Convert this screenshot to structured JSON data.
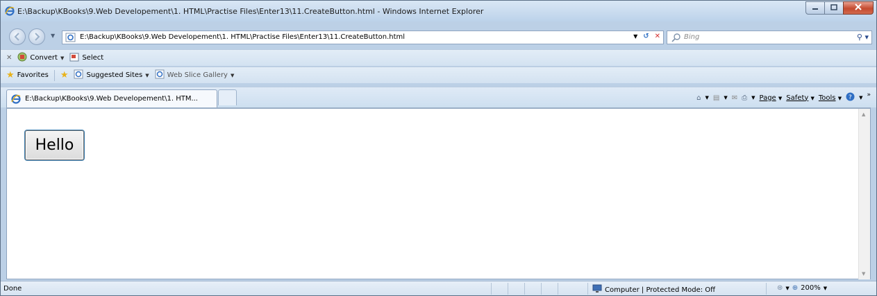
{
  "window": {
    "title": "E:\\Backup\\KBooks\\9.Web Developement\\1. HTML\\Practise Files\\Enter13\\11.CreateButton.html - Windows Internet Explorer",
    "controls": {
      "minimize": "minimize",
      "maximize": "maximize",
      "close": "close"
    }
  },
  "address_bar": {
    "url": "E:\\Backup\\KBooks\\9.Web Developement\\1. HTML\\Practise Files\\Enter13\\11.CreateButton.html"
  },
  "search": {
    "placeholder": "Bing"
  },
  "convert_toolbar": {
    "convert_label": "Convert",
    "select_label": "Select"
  },
  "favorites_bar": {
    "favorites_label": "Favorites",
    "suggested_sites_label": "Suggested Sites",
    "web_slice_gallery_label": "Web Slice Gallery"
  },
  "tab": {
    "label": "E:\\Backup\\KBooks\\9.Web Developement\\1. HTM..."
  },
  "command_bar": {
    "page_label": "Page",
    "safety_label": "Safety",
    "tools_label": "Tools"
  },
  "content": {
    "hello_button_label": "Hello"
  },
  "status_bar": {
    "status": "Done",
    "zone": "Computer | Protected Mode: Off",
    "zoom": "200%"
  },
  "colors": {
    "frame": "#bcd0e6",
    "close_button": "#c44a2f",
    "ie_blue": "#2f6fc4"
  }
}
